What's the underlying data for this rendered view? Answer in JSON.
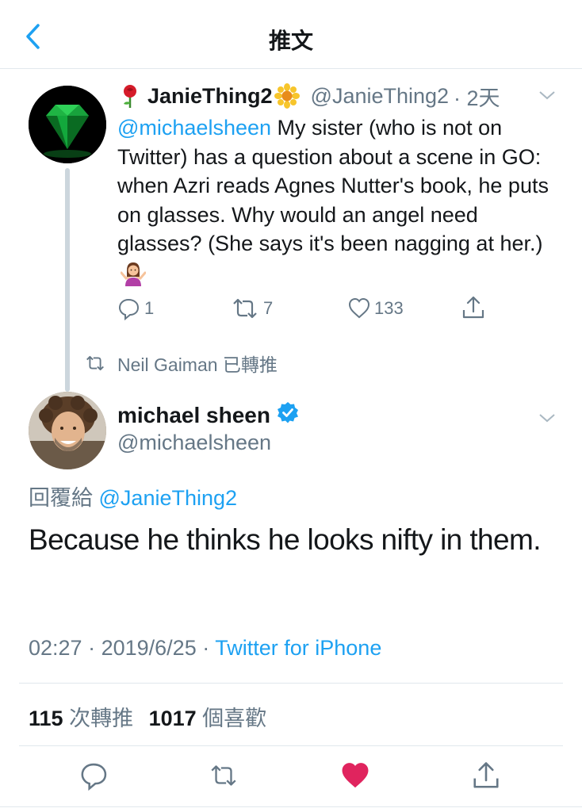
{
  "header": {
    "title": "推文",
    "back_icon": "chevron-left-icon"
  },
  "parent_tweet": {
    "name": "JanieThing2",
    "name_prefix_emoji": "rose-emoji",
    "name_suffix_emoji": "sunflower-emoji",
    "handle": "@JanieThing2",
    "time": "· 2天",
    "mention": "@michaelsheen",
    "text": " My sister (who is not on Twitter) has a question about a scene in GO: when Azri reads Agnes Nutter's book, he puts on glasses. Why would an angel need glasses? (She says it's been nagging at her.)",
    "trailing_emoji": "person-shrugging-emoji",
    "reply_count": "1",
    "retweet_count": "7",
    "like_count": "133"
  },
  "retweet_notice": {
    "text": "Neil Gaiman 已轉推"
  },
  "main_tweet": {
    "name": "michael sheen",
    "verified": true,
    "handle": "@michaelsheen",
    "reply_prefix": "回覆給 ",
    "reply_handle": "@JanieThing2",
    "text": "Because he thinks he looks nifty in them.",
    "time": "02:27",
    "date": "2019/6/25",
    "source": "Twitter for iPhone",
    "retweets": "115",
    "retweets_label": " 次轉推",
    "likes": "1017",
    "likes_label": " 個喜歡"
  },
  "colors": {
    "accent": "#1da1f2",
    "like": "#e0245e",
    "muted": "#657786",
    "text": "#14171a"
  }
}
